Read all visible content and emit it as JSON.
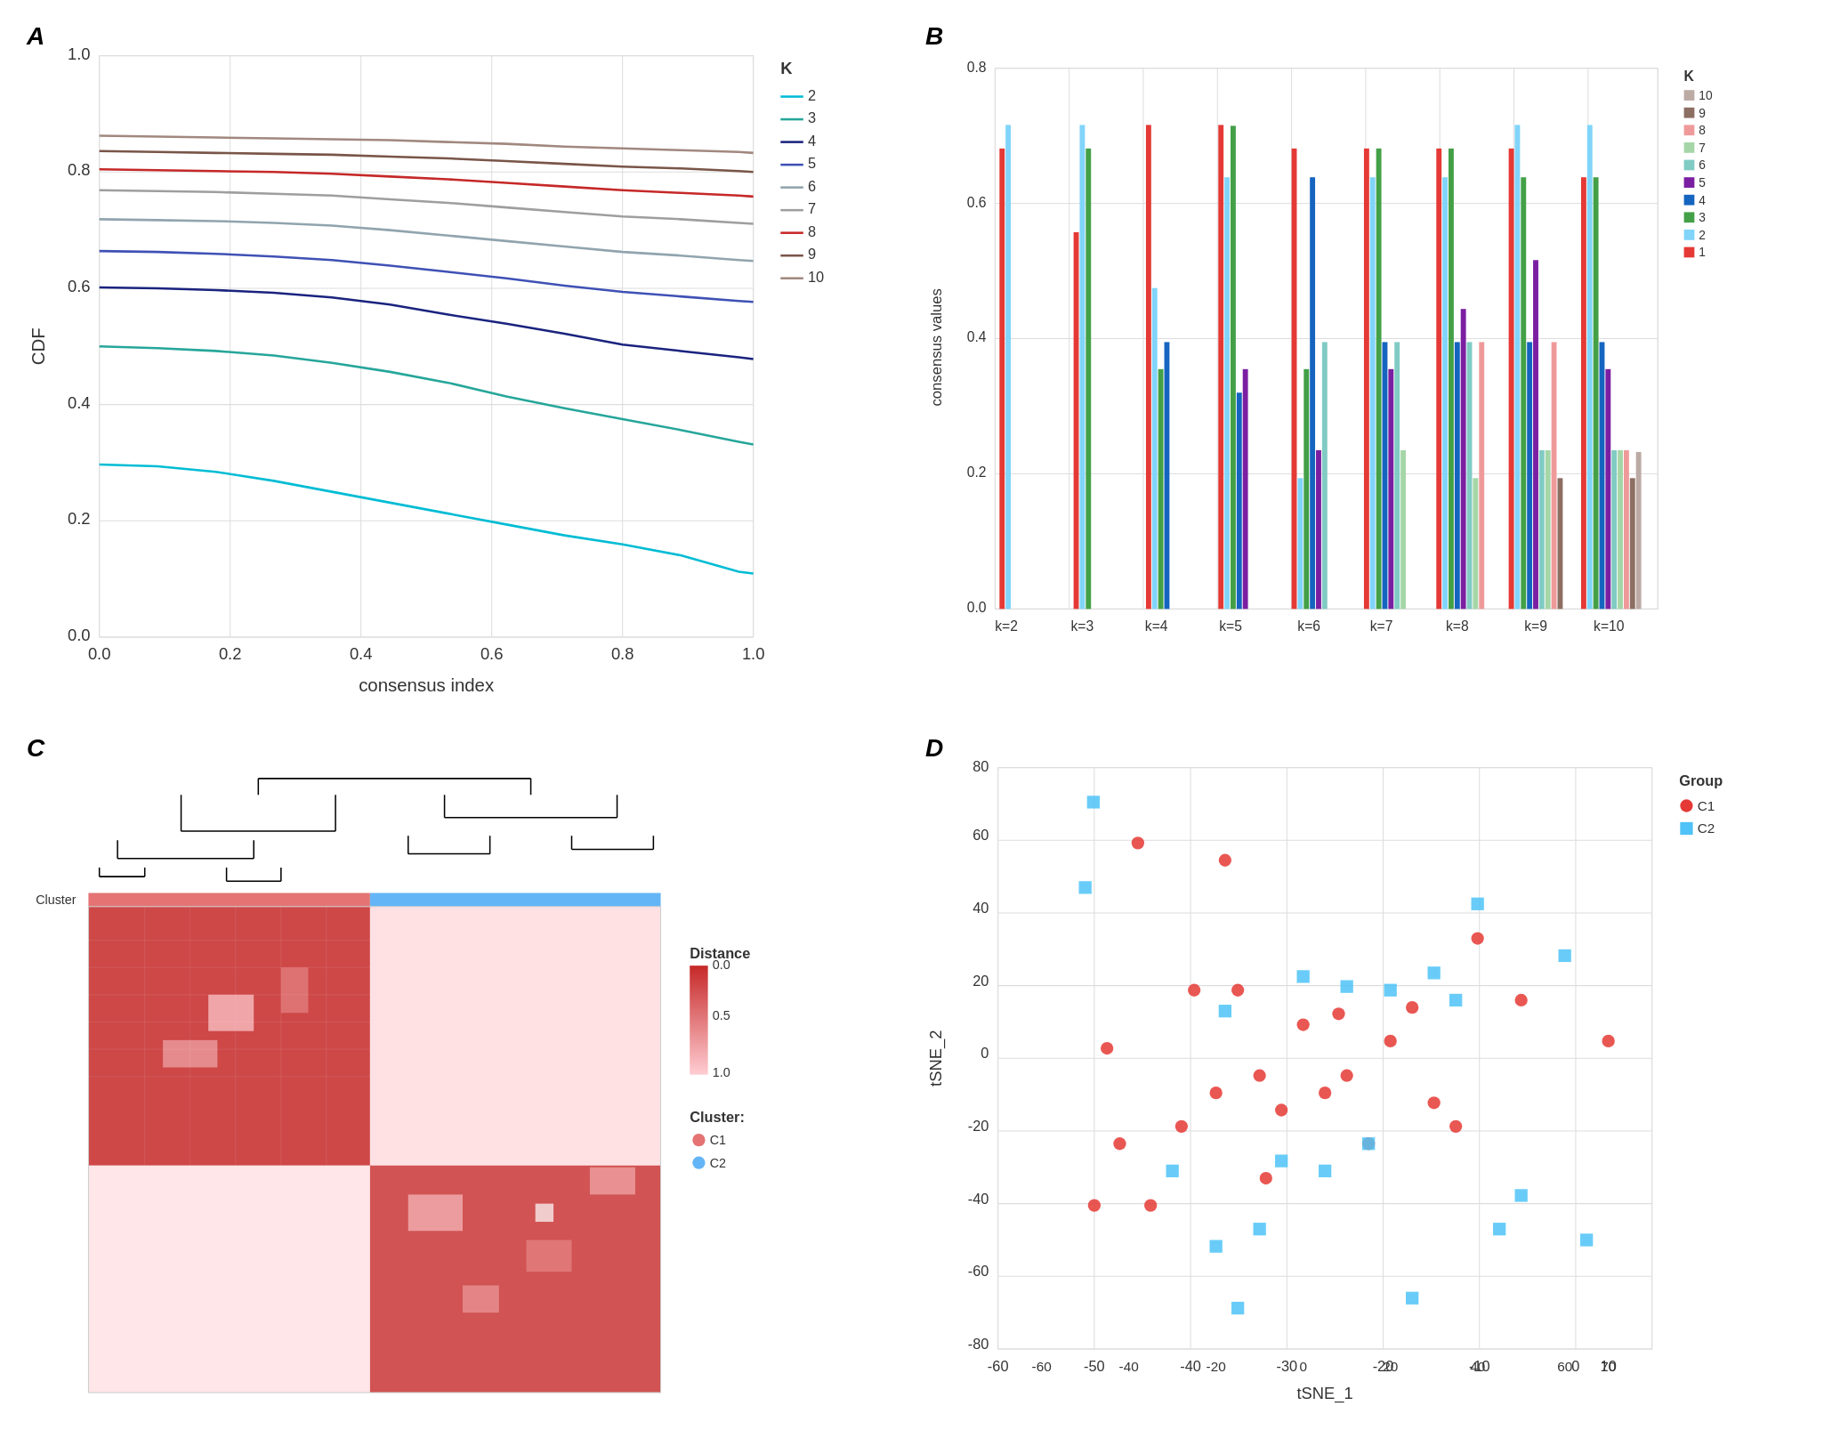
{
  "panels": {
    "A": {
      "label": "A",
      "title": "CDF",
      "x_axis": "consensus index",
      "y_axis": "CDF",
      "legend_title": "K",
      "curves": [
        {
          "k": 2,
          "color": "#00BCD4"
        },
        {
          "k": 3,
          "color": "#4DB6AC"
        },
        {
          "k": 4,
          "color": "#1A237E"
        },
        {
          "k": 5,
          "color": "#3F51B5"
        },
        {
          "k": 6,
          "color": "#B0BEC5"
        },
        {
          "k": 7,
          "color": "#9E9E9E"
        },
        {
          "k": 8,
          "color": "#C62828"
        },
        {
          "k": 9,
          "color": "#795548"
        },
        {
          "k": 10,
          "color": "#A1887F"
        }
      ]
    },
    "B": {
      "label": "B",
      "y_axis": "consensus values",
      "x_groups": [
        "k=2",
        "k=3",
        "k=4",
        "k=5",
        "k=6",
        "k=7",
        "k=8",
        "k=9",
        "k=10"
      ],
      "legend_title": "K",
      "bars": [
        {
          "k": 1,
          "color": "#E53935"
        },
        {
          "k": 2,
          "color": "#81D4FA"
        },
        {
          "k": 3,
          "color": "#43A047"
        },
        {
          "k": 4,
          "color": "#1565C0"
        },
        {
          "k": 5,
          "color": "#7B1FA2"
        },
        {
          "k": 6,
          "color": "#80CBC4"
        },
        {
          "k": 7,
          "color": "#A5D6A7"
        },
        {
          "k": 8,
          "color": "#EF9A9A"
        },
        {
          "k": 9,
          "color": "#8D6E63"
        },
        {
          "k": 10,
          "color": "#BCAAA4"
        }
      ]
    },
    "C": {
      "label": "C",
      "distance_title": "Distance",
      "distance_range": "0.0 — 1.0",
      "cluster_title": "Cluster:",
      "clusters": [
        {
          "name": "C1",
          "color": "#E57373"
        },
        {
          "name": "C2",
          "color": "#64B5F6"
        }
      ]
    },
    "D": {
      "label": "D",
      "x_axis": "tSNE_1",
      "y_axis": "tSNE_2",
      "group_title": "Group",
      "groups": [
        {
          "name": "C1",
          "color": "#E53935",
          "shape": "circle"
        },
        {
          "name": "C2",
          "color": "#4FC3F7",
          "shape": "square"
        }
      ],
      "c1_points": [
        [
          -48,
          -38
        ],
        [
          -45,
          8
        ],
        [
          -42,
          -20
        ],
        [
          -38,
          68
        ],
        [
          -35,
          -38
        ],
        [
          -28,
          -15
        ],
        [
          -25,
          25
        ],
        [
          -20,
          -5
        ],
        [
          -18,
          63
        ],
        [
          -15,
          25
        ],
        [
          -10,
          0
        ],
        [
          -8,
          -30
        ],
        [
          -5,
          -10
        ],
        [
          0,
          15
        ],
        [
          5,
          -5
        ],
        [
          8,
          18
        ],
        [
          10,
          0
        ],
        [
          15,
          -20
        ],
        [
          20,
          10
        ],
        [
          25,
          20
        ],
        [
          30,
          -8
        ],
        [
          35,
          -15
        ],
        [
          40,
          40
        ],
        [
          50,
          22
        ],
        [
          70,
          10
        ]
      ],
      "c2_points": [
        [
          -50,
          55
        ],
        [
          -48,
          80
        ],
        [
          -30,
          -28
        ],
        [
          -20,
          -50
        ],
        [
          -18,
          19
        ],
        [
          -15,
          -68
        ],
        [
          -10,
          -45
        ],
        [
          -5,
          -25
        ],
        [
          0,
          29
        ],
        [
          5,
          -30
        ],
        [
          10,
          26
        ],
        [
          15,
          -20
        ],
        [
          20,
          25
        ],
        [
          25,
          -65
        ],
        [
          30,
          30
        ],
        [
          35,
          22
        ],
        [
          40,
          50
        ],
        [
          45,
          -45
        ],
        [
          50,
          -35
        ],
        [
          60,
          35
        ],
        [
          65,
          -48
        ]
      ]
    }
  }
}
